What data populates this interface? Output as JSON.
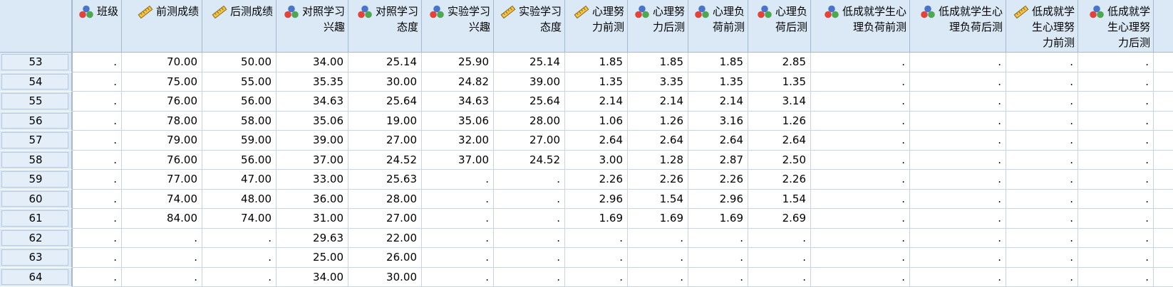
{
  "columns": [
    {
      "label": "班级",
      "icon": "nominal"
    },
    {
      "label": "前测成绩",
      "icon": "scale"
    },
    {
      "label": "后测成绩",
      "icon": "scale"
    },
    {
      "label": "对照学习兴趣",
      "icon": "nominal"
    },
    {
      "label": "对照学习态度",
      "icon": "nominal"
    },
    {
      "label": "实验学习兴趣",
      "icon": "nominal"
    },
    {
      "label": "实验学习态度",
      "icon": "scale"
    },
    {
      "label": "心理努力前测",
      "icon": "scale"
    },
    {
      "label": "心理努力后测",
      "icon": "nominal"
    },
    {
      "label": "心理负荷前测",
      "icon": "nominal"
    },
    {
      "label": "心理负荷后测",
      "icon": "nominal"
    },
    {
      "label": "低成就学生心理负荷前测",
      "icon": "nominal"
    },
    {
      "label": "低成就学生心理负荷后测",
      "icon": "nominal"
    },
    {
      "label": "低成就学生心理努力前测",
      "icon": "scale"
    },
    {
      "label": "低成就学生心理努力后测",
      "icon": "nominal"
    }
  ],
  "header_lines": [
    [
      "班级"
    ],
    [
      "前测成绩"
    ],
    [
      "后测成绩"
    ],
    [
      "对照学习",
      "兴趣"
    ],
    [
      "对照学习",
      "态度"
    ],
    [
      "实验学习",
      "兴趣"
    ],
    [
      "实验学习",
      "态度"
    ],
    [
      "心理努",
      "力前测"
    ],
    [
      "心理努",
      "力后测"
    ],
    [
      "心理负",
      "荷前测"
    ],
    [
      "心理负",
      "荷后测"
    ],
    [
      "低成就学生心",
      "理负荷前测"
    ],
    [
      "低成就学生心",
      "理负荷后测"
    ],
    [
      "低成就学",
      "生心理努",
      "力前测"
    ],
    [
      "低成就学",
      "生心理努",
      "力后测"
    ]
  ],
  "rows": [
    {
      "id": "53",
      "cells": [
        ".",
        "70.00",
        "50.00",
        "34.00",
        "25.14",
        "25.90",
        "25.14",
        "1.85",
        "1.85",
        "1.85",
        "2.85",
        ".",
        ".",
        ".",
        "."
      ]
    },
    {
      "id": "54",
      "cells": [
        ".",
        "75.00",
        "55.00",
        "35.35",
        "30.00",
        "24.82",
        "39.00",
        "1.35",
        "3.35",
        "1.35",
        "1.35",
        ".",
        ".",
        ".",
        "."
      ]
    },
    {
      "id": "55",
      "cells": [
        ".",
        "76.00",
        "56.00",
        "34.63",
        "25.64",
        "34.63",
        "25.64",
        "2.14",
        "2.14",
        "2.14",
        "3.14",
        ".",
        ".",
        ".",
        "."
      ]
    },
    {
      "id": "56",
      "cells": [
        ".",
        "78.00",
        "58.00",
        "35.06",
        "19.00",
        "35.06",
        "28.00",
        "1.06",
        "1.26",
        "3.16",
        "1.26",
        ".",
        ".",
        ".",
        "."
      ]
    },
    {
      "id": "57",
      "cells": [
        ".",
        "79.00",
        "59.00",
        "39.00",
        "27.00",
        "32.00",
        "27.00",
        "2.64",
        "2.64",
        "2.64",
        "2.64",
        ".",
        ".",
        ".",
        "."
      ]
    },
    {
      "id": "58",
      "cells": [
        ".",
        "76.00",
        "56.00",
        "37.00",
        "24.52",
        "37.00",
        "24.52",
        "3.00",
        "1.28",
        "2.87",
        "2.50",
        ".",
        ".",
        ".",
        "."
      ]
    },
    {
      "id": "59",
      "cells": [
        ".",
        "77.00",
        "47.00",
        "33.00",
        "25.63",
        ".",
        ".",
        "2.26",
        "2.26",
        "2.26",
        "2.26",
        ".",
        ".",
        ".",
        "."
      ]
    },
    {
      "id": "60",
      "cells": [
        ".",
        "74.00",
        "48.00",
        "36.00",
        "28.00",
        ".",
        ".",
        "2.96",
        "1.54",
        "2.96",
        "1.54",
        ".",
        ".",
        ".",
        "."
      ]
    },
    {
      "id": "61",
      "cells": [
        ".",
        "84.00",
        "74.00",
        "31.00",
        "27.00",
        ".",
        ".",
        "1.69",
        "1.69",
        "1.69",
        "2.69",
        ".",
        ".",
        ".",
        "."
      ]
    },
    {
      "id": "62",
      "cells": [
        ".",
        ".",
        ".",
        "29.63",
        "22.00",
        ".",
        ".",
        ".",
        ".",
        ".",
        ".",
        ".",
        ".",
        ".",
        "."
      ]
    },
    {
      "id": "63",
      "cells": [
        ".",
        ".",
        ".",
        "25.00",
        "26.00",
        ".",
        ".",
        ".",
        ".",
        ".",
        ".",
        ".",
        ".",
        ".",
        "."
      ]
    },
    {
      "id": "64",
      "cells": [
        ".",
        ".",
        ".",
        "34.00",
        "30.00",
        ".",
        ".",
        ".",
        ".",
        ".",
        ".",
        ".",
        ".",
        ".",
        "."
      ]
    }
  ],
  "colors": {
    "header_bg": "#dbe9f7",
    "grid_line": "#c7d4e1",
    "nominal_icon": [
      "#e2443b",
      "#4a74c9",
      "#4ea84f"
    ],
    "scale_icon": "#d9a21f"
  }
}
